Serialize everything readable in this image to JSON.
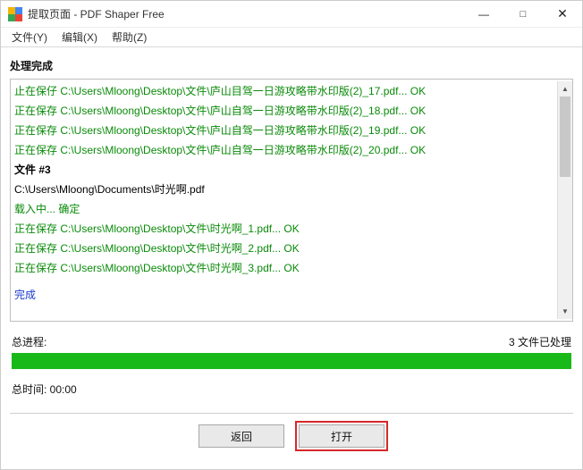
{
  "window": {
    "title": "提取页面 - PDF Shaper Free"
  },
  "menu": {
    "file": "文件(Y)",
    "edit": "编辑(X)",
    "help": "帮助(Z)"
  },
  "labels": {
    "processing_done": "处理完成",
    "total_progress": "总进程:",
    "files_processed": "3 文件已处理",
    "total_time": "总时间: 00:00"
  },
  "log": {
    "l0": "止在保仔 C:\\Users\\Mloong\\Desktop\\文件\\庐山目驾一日游攻略带水印版(2)_17.pdf... OK",
    "l1": "正在保存 C:\\Users\\Mloong\\Desktop\\文件\\庐山自驾一日游攻略带水印版(2)_18.pdf... OK",
    "l2": "正在保存 C:\\Users\\Mloong\\Desktop\\文件\\庐山自驾一日游攻略带水印版(2)_19.pdf... OK",
    "l3": "正在保存 C:\\Users\\Mloong\\Desktop\\文件\\庐山自驾一日游攻略带水印版(2)_20.pdf... OK",
    "file_header": "文件 #3",
    "file_path": "C:\\Users\\Mloong\\Documents\\时光啊.pdf",
    "loading": "载入中... 确定",
    "s1": "正在保存 C:\\Users\\Mloong\\Desktop\\文件\\时光啊_1.pdf... OK",
    "s2": "正在保存 C:\\Users\\Mloong\\Desktop\\文件\\时光啊_2.pdf... OK",
    "s3": "正在保存 C:\\Users\\Mloong\\Desktop\\文件\\时光啊_3.pdf... OK",
    "done": "完成"
  },
  "buttons": {
    "back": "返回",
    "open": "打开"
  }
}
